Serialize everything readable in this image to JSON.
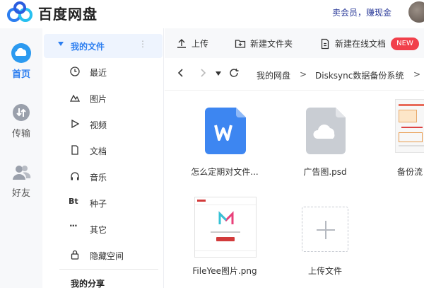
{
  "header": {
    "brand": "百度网盘",
    "vip_link": "卖会员，赚现金"
  },
  "rail": {
    "items": [
      {
        "label": "首页",
        "icon": "cloud-icon",
        "active": true
      },
      {
        "label": "传输",
        "icon": "transfer-icon",
        "active": false
      },
      {
        "label": "好友",
        "icon": "friends-icon",
        "active": false
      }
    ]
  },
  "sidebar": {
    "section": "我的文件",
    "items": [
      {
        "label": "最近",
        "icon": "clock-icon"
      },
      {
        "label": "图片",
        "icon": "image-icon"
      },
      {
        "label": "视频",
        "icon": "play-icon"
      },
      {
        "label": "文档",
        "icon": "document-icon"
      },
      {
        "label": "音乐",
        "icon": "headphones-icon"
      },
      {
        "label": "种子",
        "icon": "bt-icon"
      },
      {
        "label": "其它",
        "icon": "more-icon"
      },
      {
        "label": "隐藏空间",
        "icon": "lock-icon"
      }
    ],
    "share": "我的分享"
  },
  "toolbar": {
    "upload": "上传",
    "new_folder": "新建文件夹",
    "new_doc": "新建在线文档",
    "badge": "NEW"
  },
  "breadcrumb": {
    "root": "我的网盘",
    "folder": "Disksync数据备份系统",
    "sep": ">"
  },
  "files": [
    {
      "name": "怎么定期对文件...",
      "type": "word"
    },
    {
      "name": "广告图.psd",
      "type": "psd"
    },
    {
      "name": "备份流",
      "type": "image"
    },
    {
      "name": "FileYee图片.png",
      "type": "png"
    },
    {
      "name": "上传文件",
      "type": "upload"
    }
  ],
  "colors": {
    "accent": "#2c7ef0",
    "word_blue": "#3d86f1",
    "badge_red": "#f1404b",
    "vip_text": "#2a3a99"
  }
}
